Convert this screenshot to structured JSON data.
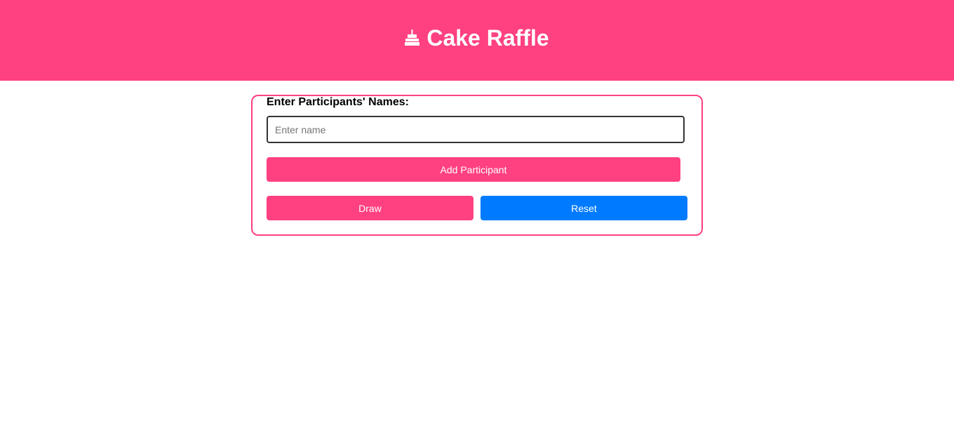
{
  "header": {
    "title": "Cake Raffle",
    "icon": "cake-icon",
    "background": "#ff4081"
  },
  "form": {
    "label": "Enter Participants' Names:",
    "input": {
      "placeholder": "Enter name",
      "value": ""
    },
    "buttons": {
      "add_label": "Add Participant",
      "draw_label": "Draw",
      "reset_label": "Reset"
    }
  },
  "colors": {
    "accent": "#ff4081",
    "reset": "#007bff"
  }
}
